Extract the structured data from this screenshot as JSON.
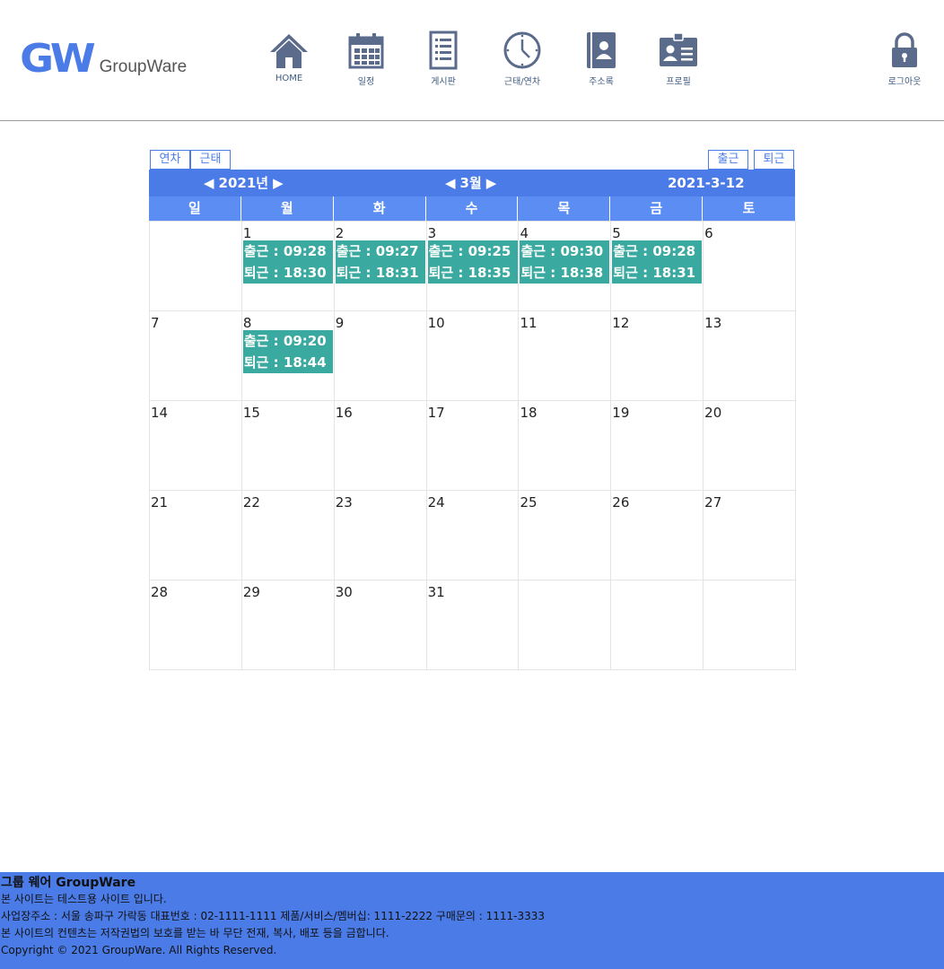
{
  "header": {
    "logo_mark": "GW",
    "logo_text": "GroupWare",
    "nav": [
      {
        "label": "HOME",
        "icon": "home-icon"
      },
      {
        "label": "일정",
        "icon": "calendar-icon"
      },
      {
        "label": "게시판",
        "icon": "board-icon"
      },
      {
        "label": "근태/연차",
        "icon": "clock-icon"
      },
      {
        "label": "주소록",
        "icon": "address-book-icon"
      },
      {
        "label": "프로필",
        "icon": "profile-card-icon"
      }
    ],
    "logout": {
      "label": "로그아웃",
      "icon": "lock-icon"
    }
  },
  "calendar": {
    "tab_leave": "연차",
    "tab_attendance": "근태",
    "btn_clock_in": "출근",
    "btn_clock_out": "퇴근",
    "year_label": "2021년",
    "month_label": "3월",
    "today_label": "2021-3-12",
    "weekdays": [
      "일",
      "월",
      "화",
      "수",
      "목",
      "금",
      "토"
    ],
    "weeks": [
      [
        "",
        "1",
        "2",
        "3",
        "4",
        "5",
        "6"
      ],
      [
        "7",
        "8",
        "9",
        "10",
        "11",
        "12",
        "13"
      ],
      [
        "14",
        "15",
        "16",
        "17",
        "18",
        "19",
        "20"
      ],
      [
        "21",
        "22",
        "23",
        "24",
        "25",
        "26",
        "27"
      ],
      [
        "28",
        "29",
        "30",
        "31",
        "",
        "",
        ""
      ]
    ],
    "attendance": {
      "1": {
        "in": "출근 : 09:28",
        "out": "퇴근 : 18:30"
      },
      "2": {
        "in": "출근 : 09:27",
        "out": "퇴근 : 18:31"
      },
      "3": {
        "in": "출근 : 09:25",
        "out": "퇴근 : 18:35"
      },
      "4": {
        "in": "출근 : 09:30",
        "out": "퇴근 : 18:38"
      },
      "5": {
        "in": "출근 : 09:28",
        "out": "퇴근 : 18:31"
      },
      "8": {
        "in": "출근 : 09:20",
        "out": "퇴근 : 18:44"
      }
    }
  },
  "footer": {
    "title": "그룹 웨어 GroupWare",
    "lines": [
      "본 사이트는 테스트용 사이트 입니다.",
      "사업장주소 : 서울 송파구 가락동 대표번호 : 02-1111-1111 제품/서비스/멤버십: 1111-2222 구매문의 : 1111-3333",
      "본 사이트의 컨텐츠는 저작권법의 보호를 받는 바 무단 전재, 복사, 배포 등을 금합니다.",
      "Copyright © 2021 GroupWare. All Rights Reserved."
    ]
  },
  "colors": {
    "accent": "#4a7be6",
    "weekday_bar": "#5c8df2",
    "attendance_bg": "#3aa9a0",
    "icon": "#5a6b8c"
  }
}
